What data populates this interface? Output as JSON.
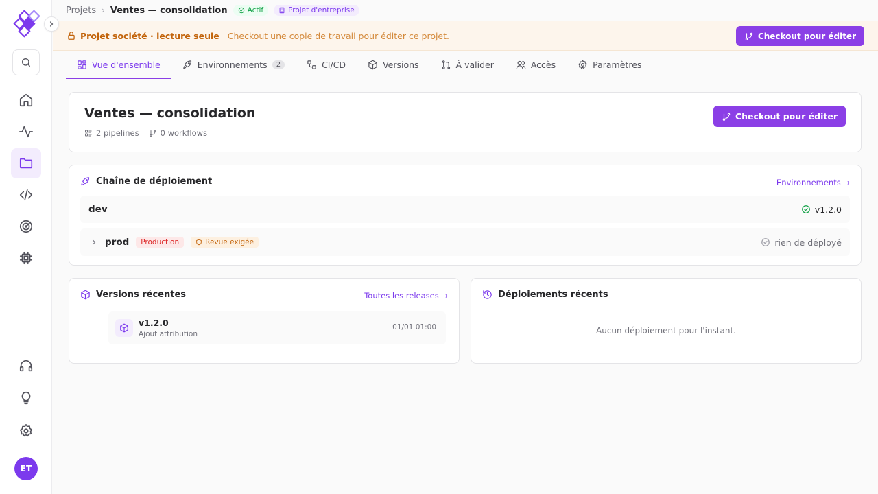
{
  "breadcrumb": {
    "root": "Projets",
    "separator": "›",
    "current": "Ventes — consolidation",
    "status_badge": "Actif",
    "type_badge": "Projet d'entreprise"
  },
  "banner": {
    "title": "Projet société · lecture seule",
    "message": "Checkout une copie de travail pour éditer ce projet.",
    "action_label": "Checkout pour éditer"
  },
  "tabs": [
    {
      "label": "Vue d'ensemble",
      "icon": "layout-grid-icon",
      "active": true
    },
    {
      "label": "Environnements",
      "icon": "rocket-icon",
      "count": "2"
    },
    {
      "label": "CI/CD",
      "icon": "workflow-icon"
    },
    {
      "label": "Versions",
      "icon": "package-icon"
    },
    {
      "label": "À valider",
      "icon": "git-pull-request-icon"
    },
    {
      "label": "Accès",
      "icon": "users-icon"
    },
    {
      "label": "Paramètres",
      "icon": "gear-icon"
    }
  ],
  "project": {
    "title": "Ventes — consolidation",
    "pipelines": "2 pipelines",
    "workflows": "0 workflows",
    "action_label": "Checkout pour éditer"
  },
  "chain": {
    "title": "Chaîne de déploiement",
    "link": "Environnements →",
    "envs": [
      {
        "name": "dev",
        "status": "v1.2.0"
      },
      {
        "name": "prod",
        "tag_production": "Production",
        "tag_review": "Revue exigée",
        "status": "rien de déployé"
      }
    ]
  },
  "versions": {
    "title": "Versions récentes",
    "link": "Toutes les releases →",
    "items": [
      {
        "name": "v1.2.0",
        "description": "Ajout attribution",
        "date": "01/01 01:00"
      }
    ]
  },
  "deployments": {
    "title": "Déploiements récents",
    "empty": "Aucun déploiement pour l'instant."
  },
  "user": {
    "initials": "ET"
  },
  "colors": {
    "accent": "#8b3fe6",
    "warning": "#c2630a",
    "success": "#16a34a",
    "danger": "#dc2626"
  }
}
